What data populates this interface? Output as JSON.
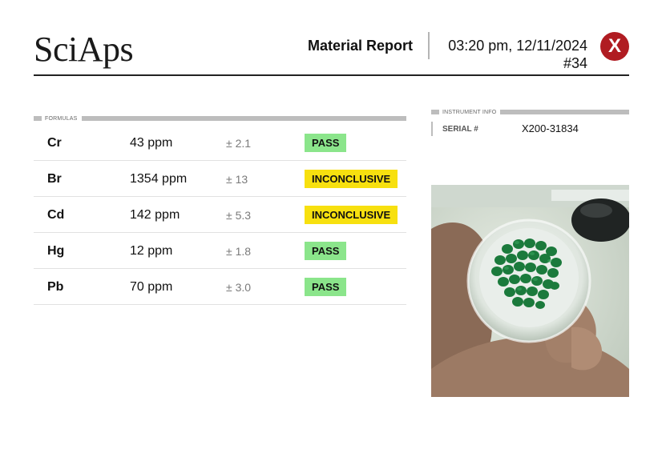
{
  "header": {
    "brand": "SciAps",
    "report_title": "Material Report",
    "datetime": "03:20 pm, 12/11/2024",
    "report_number": "#34",
    "result_badge": "X"
  },
  "formulas": {
    "section_label": "FORMULAS",
    "rows": [
      {
        "element": "Cr",
        "concentration": "43 ppm",
        "error": "± 2.1",
        "status": "PASS",
        "status_type": "pass"
      },
      {
        "element": "Br",
        "concentration": "1354 ppm",
        "error": "± 13",
        "status": "INCONCLUSIVE",
        "status_type": "inconclusive"
      },
      {
        "element": "Cd",
        "concentration": "142 ppm",
        "error": "± 5.3",
        "status": "INCONCLUSIVE",
        "status_type": "inconclusive"
      },
      {
        "element": "Hg",
        "concentration": "12 ppm",
        "error": "± 1.8",
        "status": "PASS",
        "status_type": "pass"
      },
      {
        "element": "Pb",
        "concentration": "70 ppm",
        "error": "± 3.0",
        "status": "PASS",
        "status_type": "pass"
      }
    ]
  },
  "instrument": {
    "section_label": "INSTRUMENT INFO",
    "serial_label": "SERIAL #",
    "serial_value": "X200-31834"
  },
  "colors": {
    "pass": "#8be58b",
    "inconclusive": "#f7e00f",
    "fail_badge": "#b01c22"
  },
  "photo": {
    "icon": "sample-photo",
    "subject": "green plastic pellets in a round sample cup held between fingers"
  }
}
